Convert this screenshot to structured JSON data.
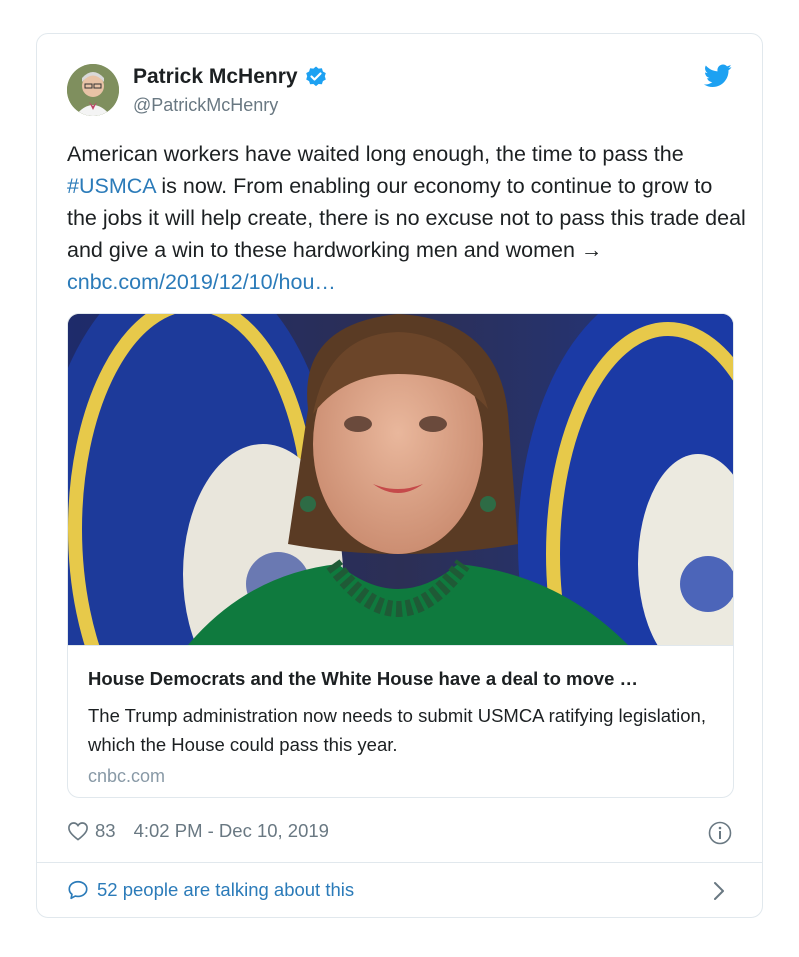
{
  "author": {
    "name": "Patrick McHenry",
    "handle": "@PatrickMcHenry",
    "verified": true
  },
  "tweet": {
    "text_part1": "American workers have waited long enough, the time to pass the ",
    "hashtag": "#USMCA",
    "text_part2": " is now. From enabling our economy to continue to grow to the jobs it will help create, there is no excuse not to pass this trade deal and give a win to these hardworking men and women → ",
    "link": "cnbc.com/2019/12/10/hou…"
  },
  "link_card": {
    "title": "House Democrats and the White House have a deal to move …",
    "description": "The Trump administration now needs to submit USMCA ratifying legislation, which the House could pass this year.",
    "domain": "cnbc.com"
  },
  "meta": {
    "likes": "83",
    "timestamp": "4:02 PM - Dec 10, 2019"
  },
  "footer": {
    "talking": "52 people are talking about this"
  },
  "icons": {
    "verified": "verified-badge-icon",
    "bird": "twitter-bird-icon",
    "heart": "heart-icon",
    "info": "info-icon",
    "bubble": "speech-bubble-icon",
    "chevron": "chevron-right-icon"
  },
  "colors": {
    "link": "#2b7bb9",
    "muted": "#697882",
    "border": "#e1e8ed",
    "verified": "#1da1f2"
  }
}
